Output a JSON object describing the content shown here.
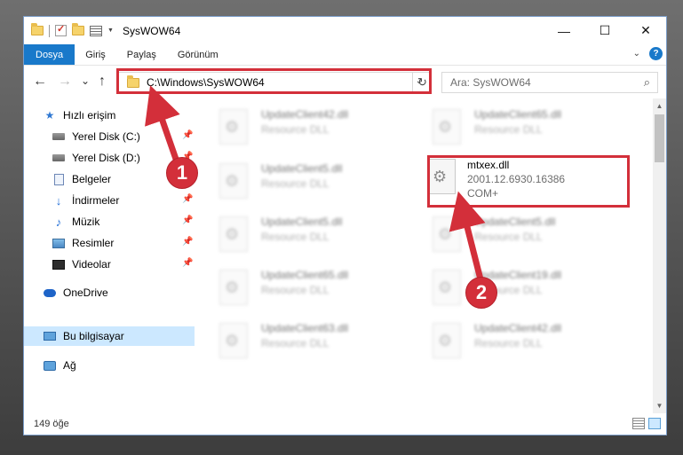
{
  "window": {
    "title": "SysWOW64",
    "controls": {
      "minimize": "—",
      "maximize": "☐",
      "close": "✕"
    }
  },
  "ribbon": {
    "tabs": [
      "Dosya",
      "Giriş",
      "Paylaş",
      "Görünüm"
    ],
    "help_label": "?"
  },
  "navigation": {
    "back": "←",
    "forward": "→",
    "recent": "⌄",
    "up": "↑",
    "address": "C:\\Windows\\SysWOW64",
    "refresh": "↻",
    "search_placeholder": "Ara: SysWOW64",
    "search_icon": "⌕"
  },
  "sidebar": {
    "items": [
      {
        "label": "Hızlı erişim",
        "icon": "star-icon",
        "pinned": false
      },
      {
        "label": "Yerel Disk (C:)",
        "icon": "drive-icon",
        "pinned": true
      },
      {
        "label": "Yerel Disk (D:)",
        "icon": "drive-icon",
        "pinned": true
      },
      {
        "label": "Belgeler",
        "icon": "documents-icon",
        "pinned": true
      },
      {
        "label": "İndirmeler",
        "icon": "downloads-icon",
        "pinned": true
      },
      {
        "label": "Müzik",
        "icon": "music-icon",
        "pinned": true
      },
      {
        "label": "Resimler",
        "icon": "pictures-icon",
        "pinned": true
      },
      {
        "label": "Videolar",
        "icon": "videos-icon",
        "pinned": true
      },
      {
        "label": "OneDrive",
        "icon": "cloud-icon",
        "pinned": false
      },
      {
        "label": "Bu bilgisayar",
        "icon": "computer-icon",
        "pinned": false,
        "selected": true
      },
      {
        "label": "Ağ",
        "icon": "network-icon",
        "pinned": false
      }
    ],
    "pin_glyph": "📌"
  },
  "files": [
    {
      "name": "UpdateClient42.dll",
      "type": "Resource DLL",
      "blurred": true
    },
    {
      "name": "UpdateClient65.dll",
      "type": "Resource DLL",
      "blurred": true
    },
    {
      "name": "UpdateClient5.dll",
      "type": "Resource DLL",
      "blurred": true
    },
    {
      "name": "mtxex.dll",
      "type": "2001.12.6930.16386",
      "extra": "COM+",
      "blurred": false
    },
    {
      "name": "UpdateClient5.dll",
      "type": "Resource DLL",
      "blurred": true
    },
    {
      "name": "UpdateClient5.dll",
      "type": "Resource DLL",
      "blurred": true
    },
    {
      "name": "UpdateClient65.dll",
      "type": "Resource DLL",
      "blurred": true
    },
    {
      "name": "UpdateClient19.dll",
      "type": "Resource DLL",
      "blurred": true
    },
    {
      "name": "UpdateClient63.dll",
      "type": "Resource DLL",
      "blurred": true
    },
    {
      "name": "UpdateClient42.dll",
      "type": "Resource DLL",
      "blurred": true
    }
  ],
  "status": {
    "item_count": "149 öğe"
  },
  "annotations": {
    "color": "#d32f3a",
    "badges": [
      "1",
      "2"
    ]
  }
}
